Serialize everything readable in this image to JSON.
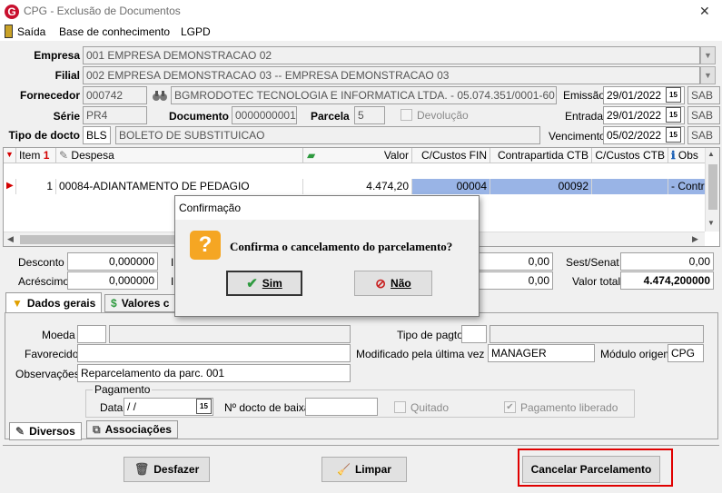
{
  "window": {
    "title": "CPG - Exclusão de Documentos",
    "close_glyph": "✕",
    "logo_letter": "G"
  },
  "menu": {
    "items": [
      "Saída",
      "Base de conhecimento",
      "LGPD"
    ]
  },
  "header": {
    "empresa_label": "Empresa",
    "empresa_value": "001 EMPRESA DEMONSTRACAO 02",
    "filial_label": "Filial",
    "filial_value": "002 EMPRESA DEMONSTRACAO 03 -- EMPRESA DEMONSTRACAO 03",
    "fornecedor_label": "Fornecedor",
    "fornecedor_code": "000742",
    "fornecedor_name": "BGMRODOTEC TECNOLOGIA E INFORMATICA LTDA. - 05.074.351/0001-60",
    "emissao_label": "Emissão",
    "emissao_value": "29/01/2022",
    "emissao_suffix": "SAB",
    "serie_label": "Série",
    "serie_value": "PR4",
    "documento_label": "Documento",
    "documento_value": "0000000001",
    "parcela_label": "Parcela",
    "parcela_value": "5",
    "devolucao_label": "Devolução",
    "entrada_label": "Entrada",
    "entrada_value": "29/01/2022",
    "entrada_suffix": "SAB",
    "tipo_label": "Tipo de docto",
    "tipo_code": "BLS",
    "tipo_name": "BOLETO DE SUBSTITUICAO",
    "vencimento_label": "Vencimento",
    "vencimento_value": "05/02/2022",
    "vencimento_suffix": "SAB",
    "cal_glyph": "15"
  },
  "grid": {
    "headers": {
      "item": "Item",
      "despesa": "Despesa",
      "valor": "Valor",
      "ccusto_fin": "C/Custos FIN",
      "contrapartida": "Contrapartida CTB",
      "ccusto_ctb": "C/Custos CTB",
      "obs": "Obs"
    },
    "rows": [
      {
        "item": "1",
        "despesa": "00084-ADIANTAMENTO DE PEDAGIO",
        "valor": "4.474,20",
        "ccusto_fin": "00004",
        "contrapartida": "00092",
        "ccusto_ctb": "",
        "obs": "- Contra"
      }
    ]
  },
  "totals": {
    "desconto_label": "Desconto",
    "desconto_value": "0,000000",
    "acrescimo_label": "Acréscimo",
    "acrescimo_value": "0,000000",
    "mid1_value": "0,00",
    "mid2_value": "0,00",
    "sest_label": "Sest/Senat",
    "sest_value": "0,00",
    "valor_total_label": "Valor total",
    "valor_total_value": "4.474,200000",
    "i_label": "I"
  },
  "tabs_top": [
    {
      "label": "Dados gerais"
    },
    {
      "label": "Valores c"
    }
  ],
  "details": {
    "moeda_label": "Moeda",
    "favorecido_label": "Favorecido",
    "observacoes_label": "Observações",
    "observacoes_value": "Reparcelamento da parc. 001",
    "tipo_pagto_label": "Tipo de pagto",
    "modificado_label": "Modificado pela última vez por",
    "modificado_value": "MANAGER",
    "modulo_label": "Módulo origem",
    "modulo_value": "CPG",
    "pagamento_group": "Pagamento",
    "data_label": "Data",
    "data_value": " /  /",
    "n_docto_label": "Nº docto de baixa",
    "quitado_label": "Quitado",
    "pago_liberado_label": "Pagamento liberado"
  },
  "tabs_bottom": [
    {
      "label": "Diversos"
    },
    {
      "label": "Associações"
    }
  ],
  "footer": {
    "desfazer_label": "Desfazer",
    "limpar_label": "Limpar",
    "cancelar_label": "Cancelar Parcelamento"
  },
  "dialog": {
    "title": "Confirmação",
    "message": "Confirma o cancelamento do parcelamento?",
    "icon_glyph": "?",
    "yes_label": "Sim",
    "no_label": "Não"
  },
  "colors": {
    "selection_row": "#99b4e6",
    "highlight_border": "#e00000",
    "dialog_icon": "#f5a623",
    "arrow_red": "#d40000"
  }
}
